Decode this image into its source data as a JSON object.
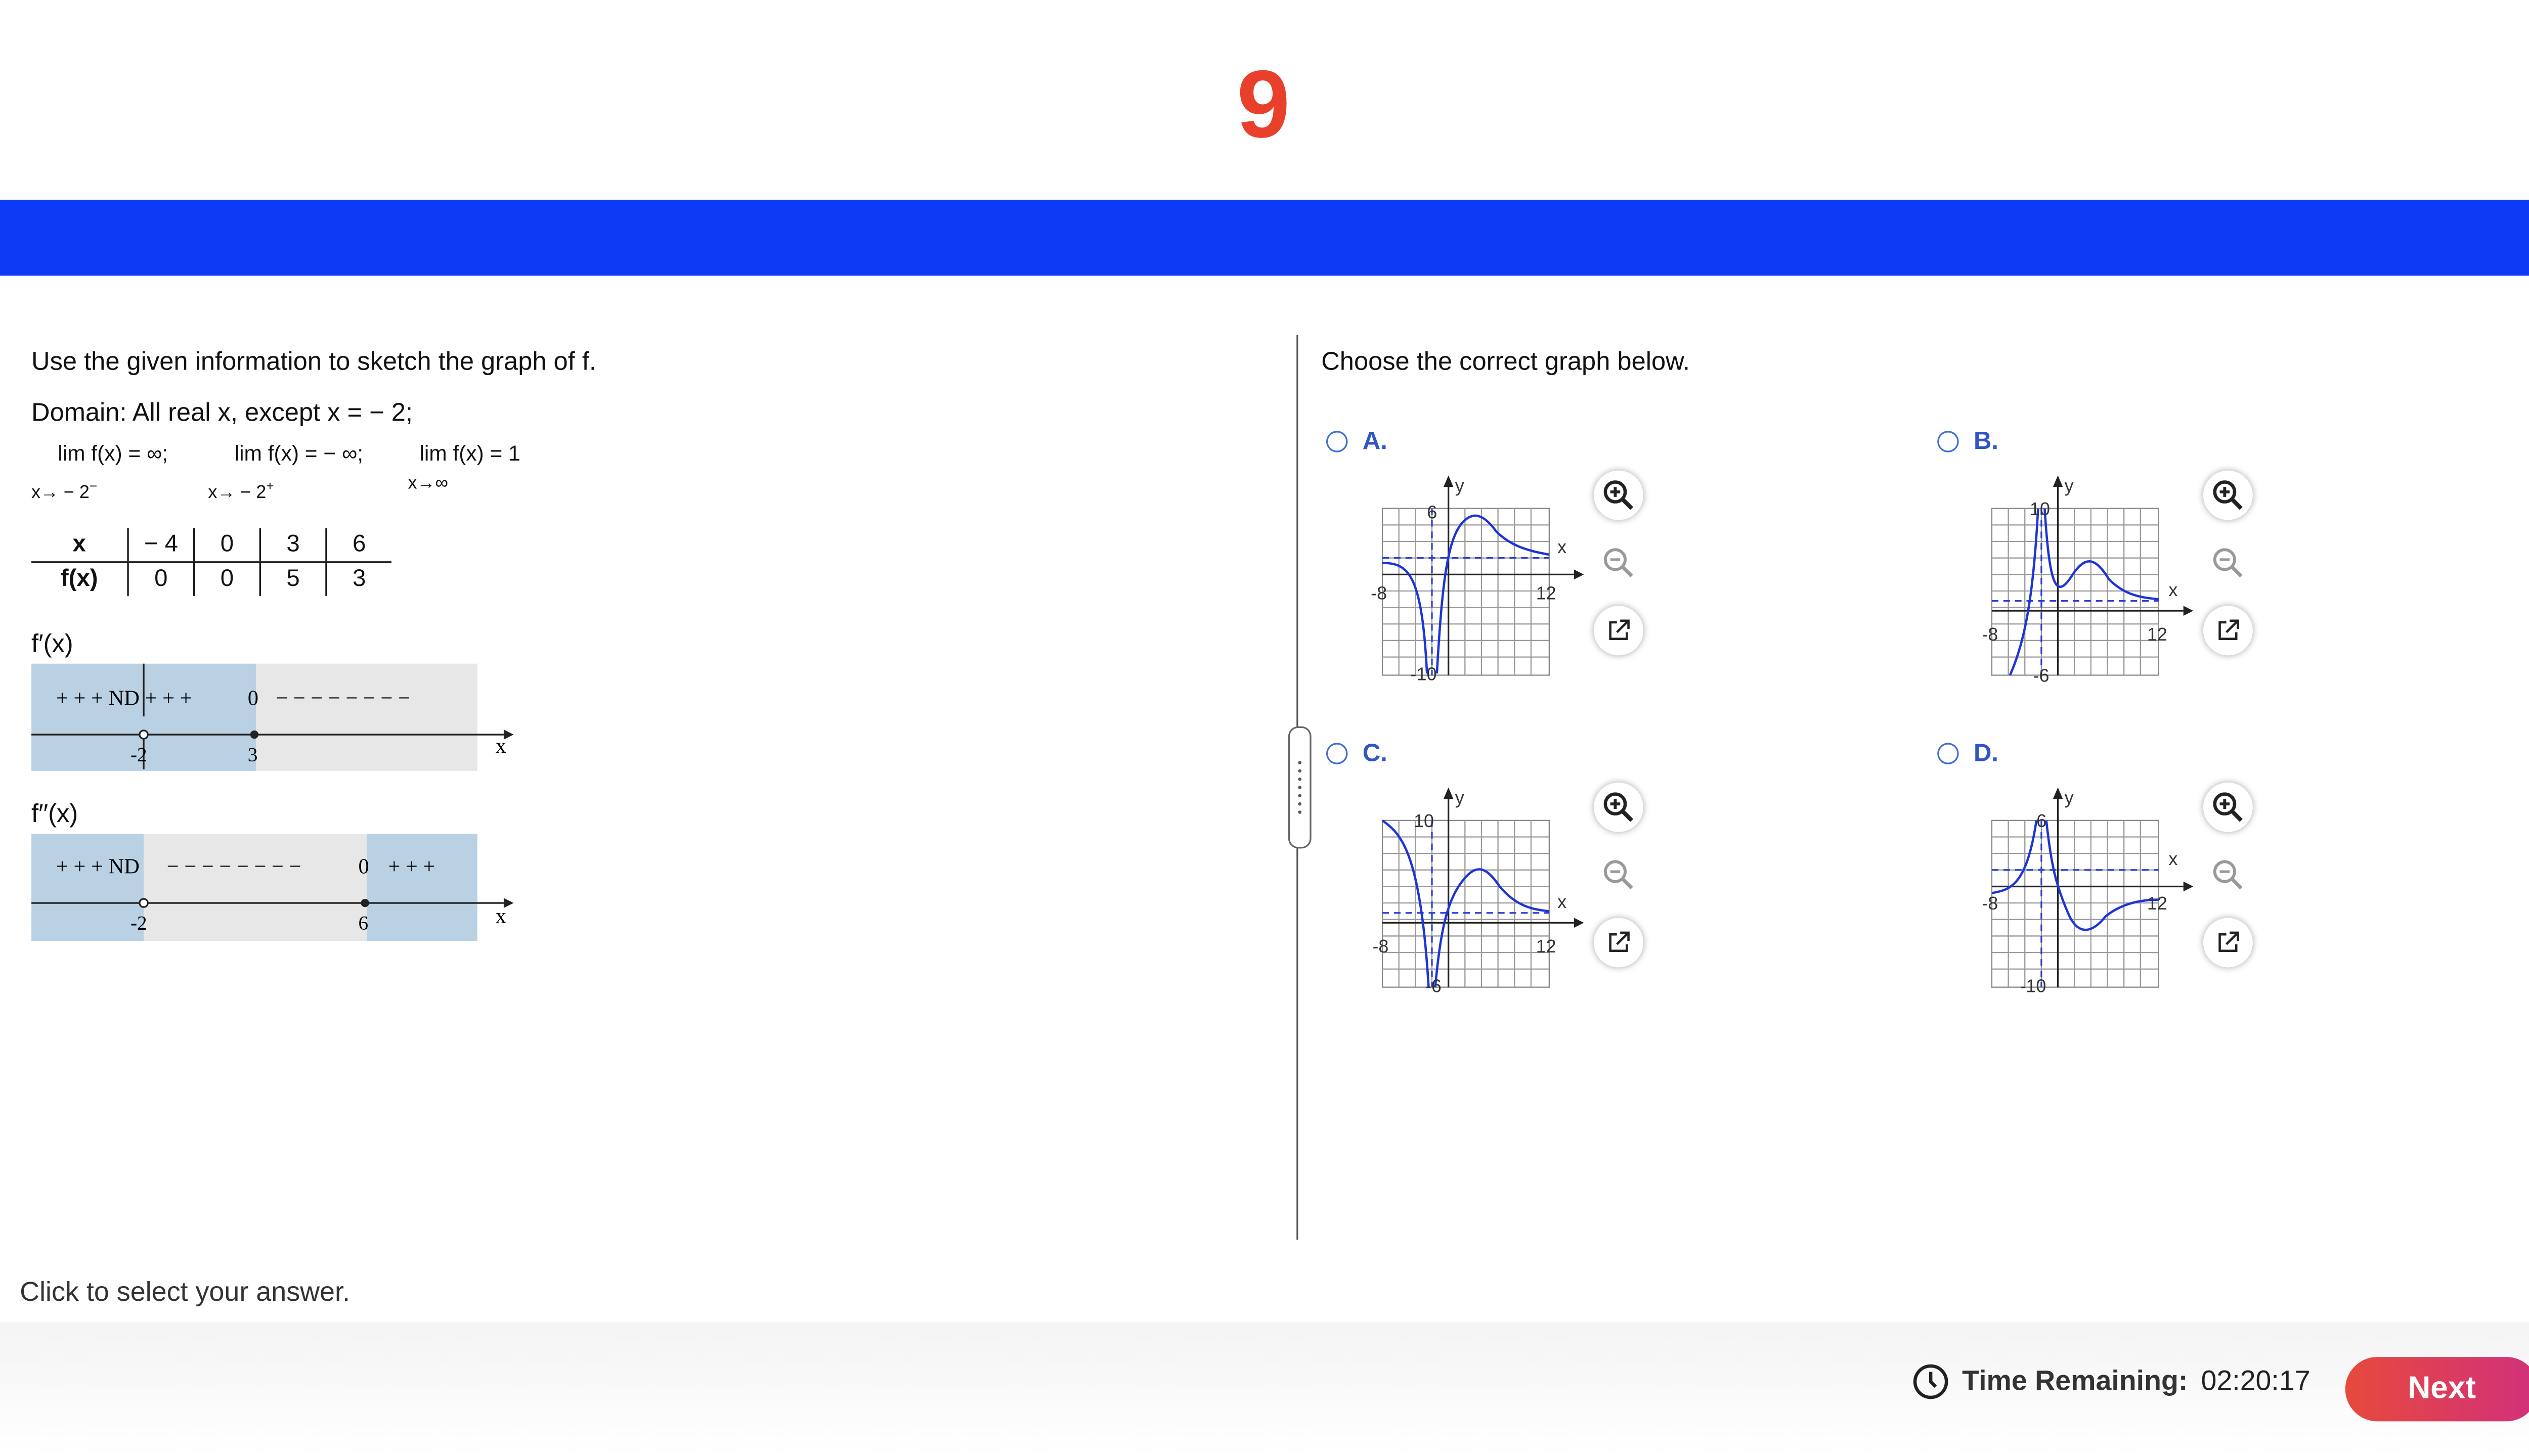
{
  "header": {
    "question_number": "9"
  },
  "left": {
    "instruction": "Use the given information to sketch the graph of f.",
    "domain": "Domain: All real x, except x = − 2;",
    "limits": [
      {
        "top": "lim   f(x) = ∞;",
        "sub": "x→ − 2",
        "sup": "−"
      },
      {
        "top": "lim   f(x) = − ∞;",
        "sub": "x→ − 2",
        "sup": "+"
      },
      {
        "top": "lim  f(x) = 1",
        "sub": "x→∞",
        "sup": ""
      }
    ],
    "table": {
      "row1": [
        "x",
        "− 4",
        "0",
        "3",
        "6"
      ],
      "row2": [
        "f(x)",
        "0",
        "0",
        "5",
        "3"
      ]
    },
    "fprime": {
      "label": "f′(x)",
      "signs_left": "+ + + ND + + +",
      "zero": "0",
      "signs_right": "− − − − − − − −",
      "ticks": [
        "-2",
        "3"
      ],
      "axis": "x"
    },
    "fdoubleprime": {
      "label": "f′′(x)",
      "signs_left": "+ + + ND",
      "signs_mid": "− − − − − − − −",
      "zero": "0",
      "signs_right": "+ + +",
      "ticks": [
        "-2",
        "6"
      ],
      "axis": "x"
    },
    "hint": "Click to select your answer."
  },
  "right": {
    "prompt": "Choose the correct graph below.",
    "options": [
      {
        "letter": "A.",
        "ytop": "6",
        "ybot": "-10",
        "xleft": "-8",
        "xright": "12"
      },
      {
        "letter": "B.",
        "ytop": "10",
        "ybot": "-6",
        "xleft": "-8",
        "xright": "12"
      },
      {
        "letter": "C.",
        "ytop": "10",
        "ybot": "-6",
        "xleft": "-8",
        "xright": "12"
      },
      {
        "letter": "D.",
        "ytop": "6",
        "ybot": "-10",
        "xleft": "-8",
        "xright": "12"
      }
    ],
    "axis_x": "x",
    "axis_y": "y"
  },
  "footer": {
    "timer_label": "Time Remaining:",
    "timer_value": "02:20:17",
    "next": "Next"
  },
  "colors": {
    "accent_red": "#e8402b",
    "banner_blue": "#0d3bf5",
    "option_blue": "#2f55c6",
    "curve_blue": "#1d35d6"
  }
}
